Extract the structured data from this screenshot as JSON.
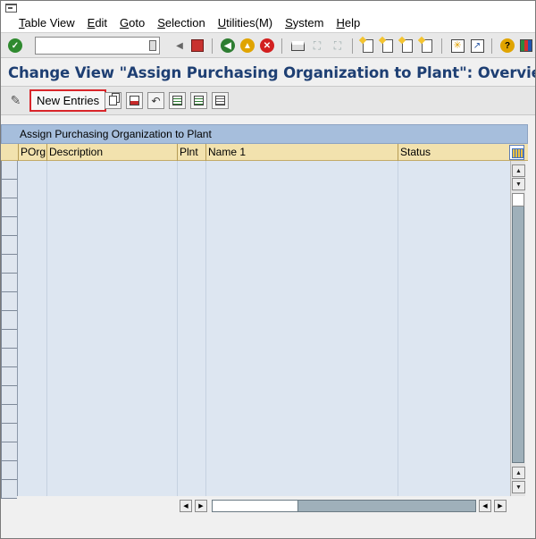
{
  "menu": {
    "items": [
      {
        "label": "Table View",
        "key": "T",
        "rest": "able View"
      },
      {
        "label": "Edit",
        "key": "E",
        "rest": "dit"
      },
      {
        "label": "Goto",
        "key": "G",
        "rest": "oto"
      },
      {
        "label": "Selection",
        "key": "S",
        "rest": "election"
      },
      {
        "label": "Utilities(M)",
        "key": "U",
        "rest": "tilities(M)"
      },
      {
        "label": "System",
        "key": "S",
        "rest": "ystem"
      },
      {
        "label": "Help",
        "key": "H",
        "rest": "elp"
      }
    ]
  },
  "toolbar": {
    "command_field_value": "",
    "icons": [
      "enter-icon",
      "save-icon",
      "back-icon",
      "exit-icon",
      "cancel-icon",
      "print-icon",
      "find-icon",
      "find-next-icon",
      "first-page-icon",
      "previous-page-icon",
      "next-page-icon",
      "last-page-icon",
      "create-session-icon",
      "shortcut-icon",
      "help-icon",
      "layout-icon"
    ]
  },
  "page": {
    "title": "Change View \"Assign Purchasing Organization to Plant\": Overview"
  },
  "app_toolbar": {
    "new_entries_label": "New Entries",
    "highlight_color": "#d9252a"
  },
  "table": {
    "title": "Assign Purchasing Organization to Plant",
    "columns": [
      "POrg",
      "Description",
      "Plnt",
      "Name 1",
      "Status"
    ],
    "rows": []
  },
  "colors": {
    "title_text": "#1e3f73",
    "table_title_bg": "#a6bedc",
    "header_bg": "#f2e2ae",
    "body_bg": "#dde6f1"
  }
}
